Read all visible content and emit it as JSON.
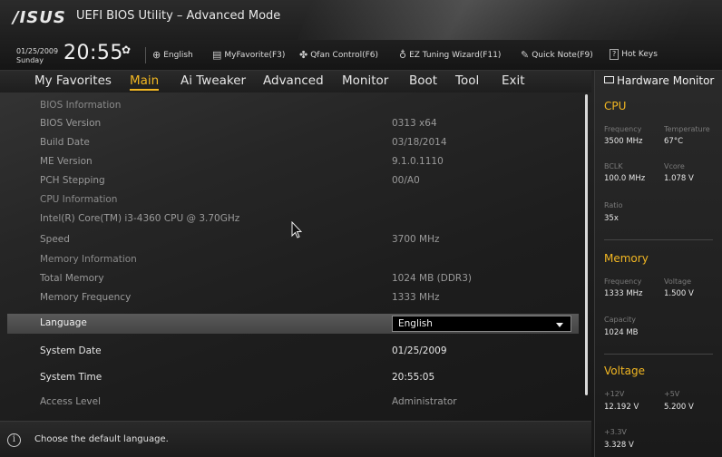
{
  "window": {
    "brand": "/ISUS",
    "title": "UEFI BIOS Utility – Advanced Mode"
  },
  "infobar": {
    "date": "01/25/2009",
    "day": "Sunday",
    "time": "20:55",
    "tools": {
      "language": "English",
      "myfavorite": "MyFavorite(F3)",
      "qfan": "Qfan Control(F6)",
      "ez_tuning": "EZ Tuning Wizard(F11)",
      "quick_note": "Quick Note(F9)",
      "hot_keys": "Hot Keys"
    }
  },
  "menu": {
    "tabs": [
      "My Favorites",
      "Main",
      "Ai Tweaker",
      "Advanced",
      "Monitor",
      "Boot",
      "Tool",
      "Exit"
    ],
    "active": "Main"
  },
  "main": {
    "bios_info_header": "BIOS Information",
    "bios_version_label": "BIOS Version",
    "bios_version": "0313 x64",
    "build_date_label": "Build Date",
    "build_date": "03/18/2014",
    "me_version_label": "ME Version",
    "me_version": "9.1.0.1110",
    "pch_stepping_label": "PCH Stepping",
    "pch_stepping": "00/A0",
    "cpu_info_header": "CPU Information",
    "cpu_name": "Intel(R) Core(TM) i3-4360 CPU @ 3.70GHz",
    "speed_label": "Speed",
    "speed": "3700 MHz",
    "memory_info_header": "Memory Information",
    "total_memory_label": "Total Memory",
    "total_memory": "1024 MB (DDR3)",
    "memory_frequency_label": "Memory Frequency",
    "memory_frequency": "1333 MHz",
    "language_label": "Language",
    "language_value": "English",
    "system_date_label": "System Date",
    "system_date": "01/25/2009",
    "system_time_label": "System Time",
    "system_time": "20:55:05",
    "access_level_label": "Access Level",
    "access_level": "Administrator"
  },
  "help": {
    "text": "Choose the default language."
  },
  "hardware_monitor": {
    "title": "Hardware Monitor",
    "cpu": {
      "header": "CPU",
      "frequency_label": "Frequency",
      "frequency": "3500 MHz",
      "temperature_label": "Temperature",
      "temperature": "67°C",
      "bclk_label": "BCLK",
      "bclk": "100.0 MHz",
      "vcore_label": "Vcore",
      "vcore": "1.078 V",
      "ratio_label": "Ratio",
      "ratio": "35x"
    },
    "memory": {
      "header": "Memory",
      "frequency_label": "Frequency",
      "frequency": "1333 MHz",
      "voltage_label": "Voltage",
      "voltage": "1.500 V",
      "capacity_label": "Capacity",
      "capacity": "1024 MB"
    },
    "voltage": {
      "header": "Voltage",
      "v12_label": "+12V",
      "v12": "12.192 V",
      "v5_label": "+5V",
      "v5": "5.200 V",
      "v33_label": "+3.3V",
      "v33": "3.328 V"
    }
  },
  "colors": {
    "accent": "#f2b722",
    "selected_row": "#4e4e4e"
  }
}
